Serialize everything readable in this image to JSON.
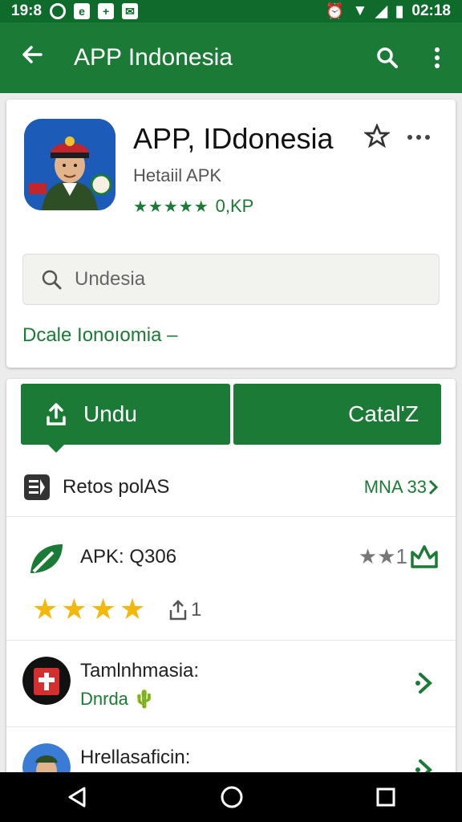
{
  "status_bar": {
    "time_left": "19:8",
    "time_right": "02:18"
  },
  "app_bar": {
    "title": "APP Indonesia"
  },
  "app_card": {
    "name": "APP, IDdonesia",
    "subtitle": "Hetaiil APK",
    "rating_stars": "★★★★★",
    "rating_text": "0,KP"
  },
  "search": {
    "placeholder": "Undesia"
  },
  "deal_link": "Dcale Ionoıomia –",
  "actions": {
    "download_label": "Undu",
    "catalog_label": "Catal'Z"
  },
  "report_row": {
    "label": "Retos polAS",
    "value": "MNA 33"
  },
  "apk_row": {
    "label": "APK: Q306",
    "mini_stars": "★★1",
    "share_count": "1",
    "stars": "★★★★"
  },
  "list": [
    {
      "title": "Tamlnhmasia:",
      "subtitle": "Dnrda"
    },
    {
      "title": "Hrellasaficin:",
      "subtitle": ""
    }
  ],
  "colors": {
    "brand": "#1b7a35",
    "status": "#0e6b2b"
  }
}
